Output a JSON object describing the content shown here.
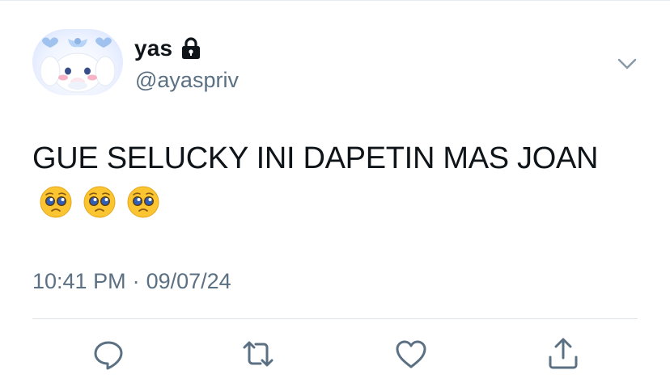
{
  "user": {
    "display_name": "yas",
    "handle": "@ayaspriv",
    "protected": true
  },
  "tweet": {
    "text": "GUE SELUCKY INI DAPETIN MAS JOAN",
    "emoji": [
      "pleading-face",
      "pleading-face",
      "pleading-face"
    ],
    "time": "10:41 PM",
    "separator": "·",
    "date": "09/07/24"
  },
  "actions": [
    "reply",
    "retweet",
    "like",
    "share"
  ],
  "colors": {
    "text": "#0f1419",
    "secondary": "#5b7083",
    "icon": "#5b7083",
    "divider": "#dfe4e8"
  }
}
